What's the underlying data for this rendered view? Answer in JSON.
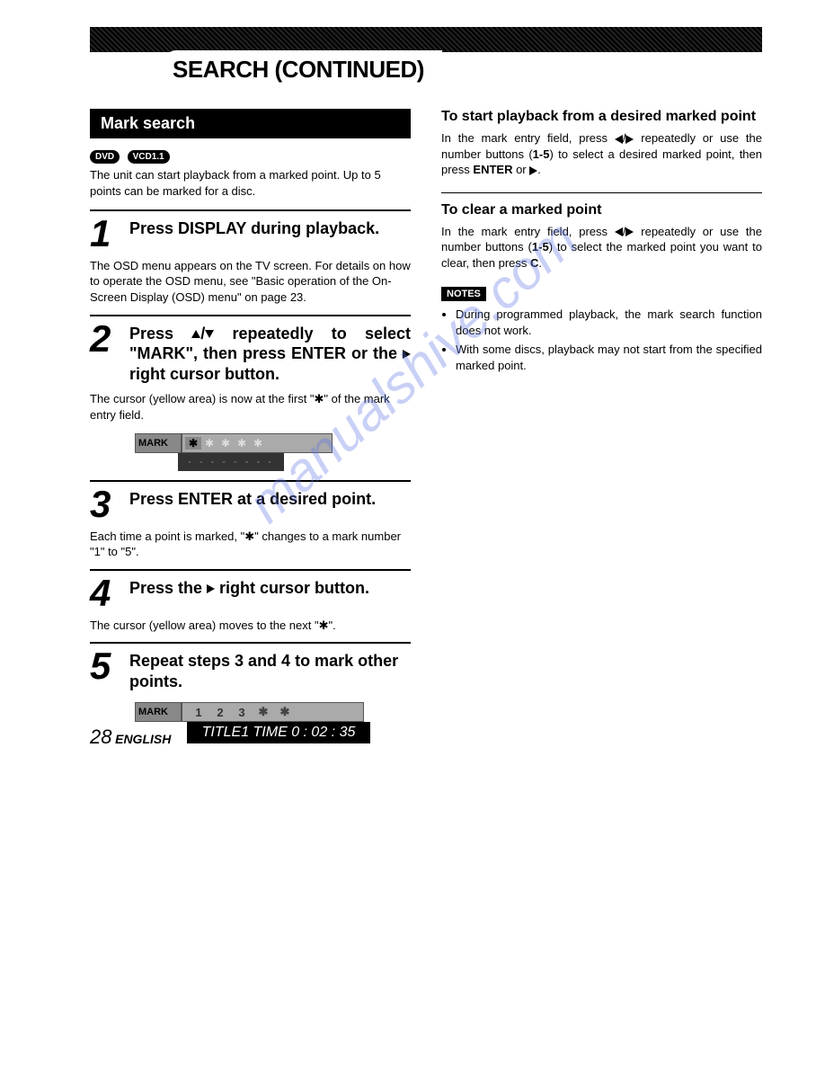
{
  "header": {
    "title": "SEARCH (CONTINUED)"
  },
  "left": {
    "section_title": "Mark search",
    "badges": [
      "DVD",
      "VCD1.1"
    ],
    "intro": "The unit can start playback from a marked point. Up to 5 points can be marked for a disc.",
    "steps": [
      {
        "num": "1",
        "head": "Press DISPLAY during playback.",
        "after": "The OSD menu appears on the TV screen. For details on how to operate the OSD menu, see \"Basic operation of the On-Screen Display (OSD) menu\" on page 23."
      },
      {
        "num": "2",
        "head_parts": [
          "Press ",
          "/",
          " repeatedly to select \"MARK\", then press ENTER or the ",
          " right cursor button."
        ],
        "after": "The cursor (yellow area) is now at the first \"✱\" of the mark entry field."
      },
      {
        "num": "3",
        "head": "Press ENTER at a desired point.",
        "after": "Each time a point is marked, \"✱\" changes to a mark number \"1\" to \"5\"."
      },
      {
        "num": "4",
        "head_parts": [
          "Press the ",
          " right cursor button."
        ],
        "after": "The cursor (yellow area) moves to the next \"✱\"."
      },
      {
        "num": "5",
        "head": "Repeat steps 3 and 4 to mark other points."
      }
    ],
    "osd1": {
      "label": "MARK",
      "active": "✱",
      "stars": [
        "✱",
        "✱",
        "✱",
        "✱"
      ],
      "dashes": "- - - - - - - -"
    },
    "osd2": {
      "label": "MARK",
      "cells": [
        "1",
        "2",
        "3",
        "✱",
        "✱"
      ],
      "title_line": "TITLE1   TIME 0 : 02 : 35"
    }
  },
  "right": {
    "sec1_title": "To start playback from a desired marked point",
    "sec1_body_parts": [
      "In the mark entry field, press ",
      "/",
      " repeatedly or use the number buttons (",
      "1-5",
      ") to select a desired marked point, then press ",
      "ENTER",
      " or ",
      "."
    ],
    "sec2_title": "To clear a marked point",
    "sec2_body_parts": [
      "In the mark entry field, press ",
      "/",
      " repeatedly or use the number buttons (",
      "1-5",
      ") to select the marked point you want to clear, then press ",
      "C",
      "."
    ],
    "notes_label": "NOTES",
    "notes": [
      "During programmed playback, the mark search function does not work.",
      "With some discs, playback may not start from the specified marked point."
    ]
  },
  "footer": {
    "page_number": "28",
    "language": "ENGLISH"
  },
  "watermark": "manualshive.com"
}
